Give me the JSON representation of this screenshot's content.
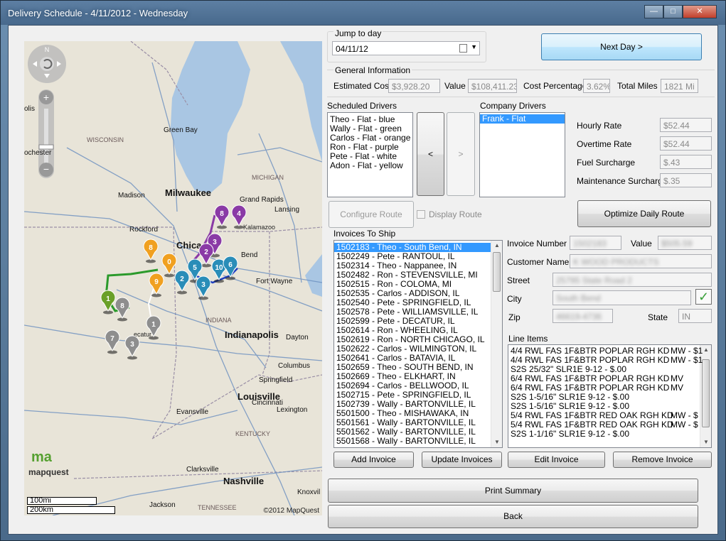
{
  "window": {
    "title": "Delivery Schedule - 4/11/2012 - Wednesday",
    "controls": [
      "—",
      "□",
      "✕"
    ]
  },
  "jump": {
    "label": "Jump to day",
    "date": "04/11/12",
    "next_day": "Next Day >"
  },
  "general": {
    "label": "General Information",
    "estimated_cost_label": "Estimated Cost",
    "estimated_cost": "$3,928.20",
    "value_label": "Value",
    "value": "$108,411.23",
    "cost_pct_label": "Cost Percentage",
    "cost_pct": "3.62%",
    "total_miles_label": "Total Miles",
    "total_miles": "1821 Mi"
  },
  "drivers": {
    "scheduled_label": "Scheduled Drivers",
    "scheduled": [
      "Theo - Flat - blue",
      "Wally - Flat - green",
      "Carlos - Flat - orange",
      "Ron - Flat - purple",
      "Pete - Flat - white",
      "Adon - Flat - yellow"
    ],
    "move_left": "<",
    "move_right": ">",
    "company_label": "Company Drivers",
    "company": [
      "Frank - Flat"
    ]
  },
  "rates": {
    "hourly_label": "Hourly Rate",
    "hourly": "$52.44",
    "overtime_label": "Overtime Rate",
    "overtime": "$52.44",
    "fuel_label": "Fuel Surcharge",
    "fuel": "$.43",
    "maint_label": "Maintenance Surcharge",
    "maint": "$.35"
  },
  "route": {
    "configure": "Configure Route",
    "display": "Display Route",
    "optimize": "Optimize Daily Route"
  },
  "invoices": {
    "label": "Invoices To Ship",
    "items": [
      "1502183 - Theo - South Bend, IN",
      "1502249 - Pete - RANTOUL, IL",
      "1502314 - Theo - Nappanee, IN",
      "1502482 - Ron - STEVENSVILLE, MI",
      "1502515 - Ron - COLOMA, MI",
      "1502535 - Carlos - ADDISON, IL",
      "1502540 - Pete - SPRINGFIELD, IL",
      "1502578 - Pete - WILLIAMSVILLE, IL",
      "1502599 - Pete - DECATUR, IL",
      "1502614 - Ron - WHEELING, IL",
      "1502619 - Ron - NORTH CHICAGO, IL",
      "1502622 - Carlos - WILMINGTON, IL",
      "1502641 - Carlos - BATAVIA, IL",
      "1502659 - Theo - SOUTH BEND, IN",
      "1502669 - Theo - ELKHART, IN",
      "1502694 - Carlos - BELLWOOD, IL",
      "1502715 - Pete - SPRINGFIELD, IL",
      "1502739 - Wally - BARTONVILLE, IL",
      "5501500 - Theo - MISHAWAKA, IN",
      "5501561 - Wally - BARTONVILLE, IL",
      "5501562 - Wally - BARTONVILLE, IL",
      "5501568 - Wally - BARTONVILLE, IL"
    ],
    "add": "Add Invoice",
    "update": "Update Invoices"
  },
  "invoice_detail": {
    "number_label": "Invoice Number",
    "number": "1502183",
    "value_label": "Value",
    "value": "$505.59",
    "customer_label": "Customer Name",
    "customer": "K WOOD PRODUCTS",
    "street_label": "Street",
    "street": "25795 State Road 2",
    "city_label": "City",
    "city": "South Bend",
    "zip_label": "Zip",
    "zip": "46619-4736",
    "state_label": "State",
    "state": "IN",
    "check": "✓"
  },
  "line_items": {
    "label": "Line Items",
    "items": [
      [
        "4/4 RWL FAS 1F&BTR POPLAR RGH KD",
        "MW - $1"
      ],
      [
        "4/4 RWL FAS 1F&BTR POPLAR RGH KD",
        "MW - $1"
      ],
      [
        "S2S 25/32\" SLR1E  9-12 - $.00",
        ""
      ],
      [
        "6/4 RWL FAS 1F&BTR POPLAR RGH KD",
        "MV"
      ],
      [
        "6/4 RWL FAS 1F&BTR POPLAR RGH KD",
        "MV"
      ],
      [
        "S2S 1-5/16\" SLR1E  9-12 - $.00",
        ""
      ],
      [
        "S2S 1-5/16\" SLR1E  9-12 - $.00",
        ""
      ],
      [
        "5/4 RWL FAS 1F&BTR RED OAK RGH KD",
        "MW - $"
      ],
      [
        "5/4 RWL FAS 1F&BTR RED OAK RGH KD",
        "MW - $"
      ],
      [
        "S2S 1-1/16\" SLR1E  9-12 - $.00",
        ""
      ]
    ],
    "edit": "Edit Invoice",
    "remove": "Remove Invoice"
  },
  "footer": {
    "print": "Print Summary",
    "back": "Back"
  },
  "map": {
    "compass": "N",
    "labels": [
      {
        "t": "WISCONSIN",
        "k": "state"
      },
      {
        "t": "Green Bay",
        "k": "city"
      },
      {
        "t": "Madison",
        "k": "city"
      },
      {
        "t": "Milwaukee",
        "k": "big"
      },
      {
        "t": "MICHIGAN",
        "k": "state"
      },
      {
        "t": "Grand Rapids",
        "k": "city"
      },
      {
        "t": "Lansing",
        "k": "city"
      },
      {
        "t": "Kalamazoo",
        "k": "small"
      },
      {
        "t": "Rockford",
        "k": "city"
      },
      {
        "t": "Chica",
        "k": "big"
      },
      {
        "t": "Bend",
        "k": "city"
      },
      {
        "t": "Fort Wayne",
        "k": "city"
      },
      {
        "t": "INDIANA",
        "k": "state"
      },
      {
        "t": "Indianapolis",
        "k": "big"
      },
      {
        "t": "Dayton",
        "k": "city"
      },
      {
        "t": "Columbus",
        "k": "city"
      },
      {
        "t": "Springfield",
        "k": "city"
      },
      {
        "t": "Cincinnati",
        "k": "city"
      },
      {
        "t": "Louisville",
        "k": "big"
      },
      {
        "t": "Lexington",
        "k": "city"
      },
      {
        "t": "Evansville",
        "k": "city"
      },
      {
        "t": "KENTUCKY",
        "k": "state"
      },
      {
        "t": "Clarksville",
        "k": "city"
      },
      {
        "t": "Nashville",
        "k": "big"
      },
      {
        "t": "Knoxvil",
        "k": "city"
      },
      {
        "t": "TENNESSEE",
        "k": "state"
      },
      {
        "t": "Jackson",
        "k": "city"
      },
      {
        "t": "ecatur",
        "k": "small"
      },
      {
        "t": "olis",
        "k": "city"
      },
      {
        "t": "ochester",
        "k": "city"
      }
    ],
    "markers": [
      {
        "n": "8",
        "c": "purple"
      },
      {
        "n": "4",
        "c": "purple"
      },
      {
        "n": "3",
        "c": "purple"
      },
      {
        "n": "2",
        "c": "purple"
      },
      {
        "n": "5",
        "c": "blue"
      },
      {
        "n": "10",
        "c": "blue"
      },
      {
        "n": "6",
        "c": "blue"
      },
      {
        "n": "2",
        "c": "blue"
      },
      {
        "n": "3",
        "c": "blue"
      },
      {
        "n": "9",
        "c": "orange"
      },
      {
        "n": "8",
        "c": "orange"
      },
      {
        "n": "0",
        "c": "orange"
      },
      {
        "n": "1",
        "c": "green"
      },
      {
        "n": "8",
        "c": "gray"
      },
      {
        "n": "1",
        "c": "gray"
      },
      {
        "n": "7",
        "c": "gray"
      },
      {
        "n": "3",
        "c": "gray"
      }
    ],
    "brand": "mapquest",
    "scale_mi": "100mi",
    "scale_km": "200km",
    "copyright": "©2012 MapQuest"
  },
  "colors": {
    "purple": "#8a3aa6",
    "blue": "#2a8db8",
    "orange": "#f0a020",
    "green": "#6aa028",
    "gray": "#8e8e8e",
    "selection": "#3399ff",
    "lake": "#a9c6e3"
  }
}
